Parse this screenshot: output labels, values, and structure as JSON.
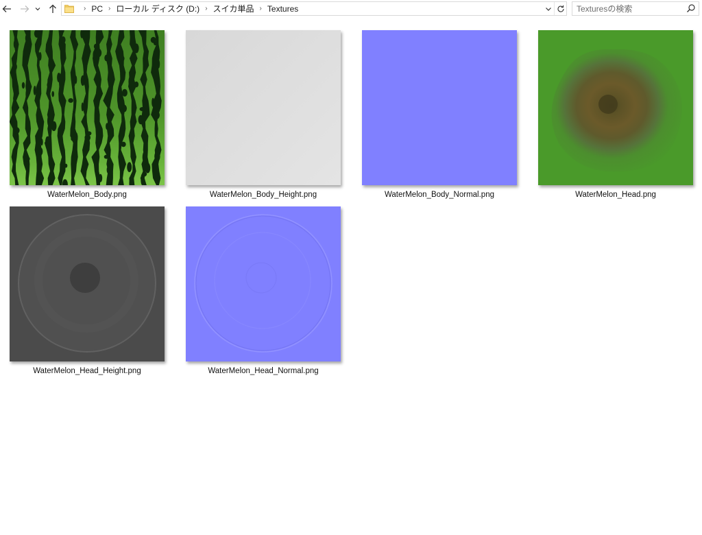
{
  "breadcrumb": {
    "items": [
      "PC",
      "ローカル ディスク (D:)",
      "スイカ単品",
      "Textures"
    ]
  },
  "search": {
    "placeholder": "Texturesの検索"
  },
  "files": [
    {
      "name": "WaterMelon_Body.png"
    },
    {
      "name": "WaterMelon_Body_Height.png"
    },
    {
      "name": "WaterMelon_Body_Normal.png"
    },
    {
      "name": "WaterMelon_Head.png"
    },
    {
      "name": "WaterMelon_Head_Height.png"
    },
    {
      "name": "WaterMelon_Head_Normal.png"
    }
  ],
  "colors": {
    "body_green": "#4f9a2a",
    "stripe_dark": "#0f2a0c",
    "height_light": "#dcdcdc",
    "normal_blue": "#8080ff",
    "head_green": "#4a9a2a",
    "head_brown": "#6b5a2a",
    "head_height_gray": "#4b4b4b"
  },
  "icons": {
    "back": "arrow-left-icon",
    "forward": "arrow-right-icon",
    "recent": "chevron-down-icon",
    "up": "arrow-up-icon",
    "folder": "folder-icon",
    "refresh": "refresh-icon",
    "search": "search-icon"
  }
}
